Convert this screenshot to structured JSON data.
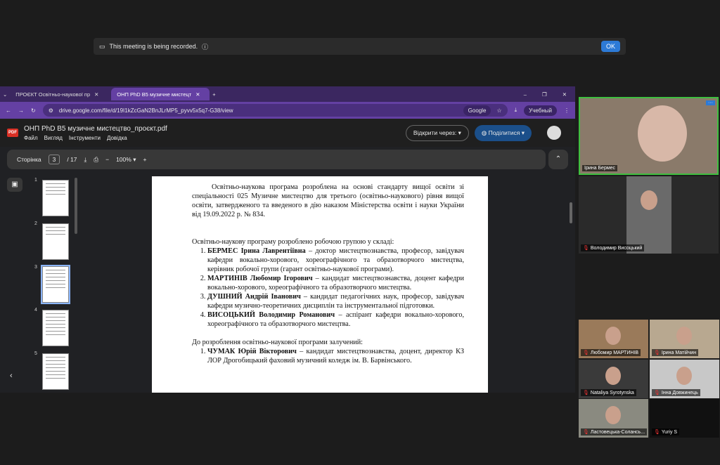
{
  "banner": {
    "text": "This meeting is being recorded.",
    "ok": "OK"
  },
  "browser": {
    "tabs": [
      {
        "label": "ПРОЄКТ Освітньо-наукової пр"
      },
      {
        "label": "ОНП PhD B5 музичне мистецт"
      }
    ],
    "url": "drive.google.com/file/d/19I1kZcGaN2BnJLrMP5_pyvv5x5q7-G38/view",
    "google": "Google",
    "profile": "Учебный"
  },
  "drive": {
    "title": "ОНП PhD B5 музичне мистецтво_проєкт.pdf",
    "menu": [
      "Файл",
      "Вигляд",
      "Інструменти",
      "Довідка"
    ],
    "open_with": "Відкрити через:",
    "share": "Поділитися"
  },
  "toolbar": {
    "page_label": "Сторінка",
    "page": "3",
    "total": "/ 17",
    "zoom": "100%"
  },
  "thumbs": [
    "1",
    "2",
    "3",
    "4",
    "5"
  ],
  "doc": {
    "intro": "Освітньо-наукова програма розроблена на основі стандарту вищої освіти зі спеціальності 025 Музичне мистецтво для третього (освітньо-наукового) рівня вищої освіти, затвердженого та введеного в дію наказом Міністерства освіти і науки України від 19.09.2022 р. № 834.",
    "group_heading": "Освітньо-наукову програму розроблено робочою групою у складі:",
    "members": [
      {
        "name": "БЕРМЕС Ірина Лаврентіївна",
        "desc": " – доктор мистецтвознавства, професор, завідувач кафедри вокально-хорового, хореографічного та образотворчого мистецтва, керівник робочої групи (гарант освітньо-наукової програми)."
      },
      {
        "name": "МАРТИНІВ Любомир Ігорович",
        "desc": " – кандидат мистецтвознавства, доцент кафедри вокально-хорового, хореографічного та образотворчого мистецтва."
      },
      {
        "name": "ДУШНИЙ Андрій Іванович",
        "desc": " – кандидат педагогічних наук, професор, завідувач кафедри музично-теоретичних дисциплін та інструментальної підготовки."
      },
      {
        "name": "ВИСОЦЬКИЙ Володимир Романович",
        "desc": " – аспірант кафедри вокально-хорового, хореографічного та образотворчого мистецтва."
      }
    ],
    "involved_heading": "До розроблення освітньо-наукової програми залучений:",
    "involved": [
      {
        "name": "ЧУМАК Юрій Вікторович",
        "desc": " – кандидат мистецтвознавства, доцент, директор КЗ ЛОР Дрогобицький фаховий музичний коледж ім. В. Барвінського."
      }
    ]
  },
  "participants": [
    "Ірина Бермес",
    "Володимир Висоцький",
    "Любомир МАРТИНІВ",
    "Ірина Матійчин",
    "Nataliya Syrotynska",
    "Інна Довжинець",
    "Ластовецька-Солансь...",
    "Yuriy S"
  ],
  "colors": {
    "active_speaker": "#3fbf3f",
    "tabbar": "#3b2760",
    "addressbar": "#6440a3"
  }
}
